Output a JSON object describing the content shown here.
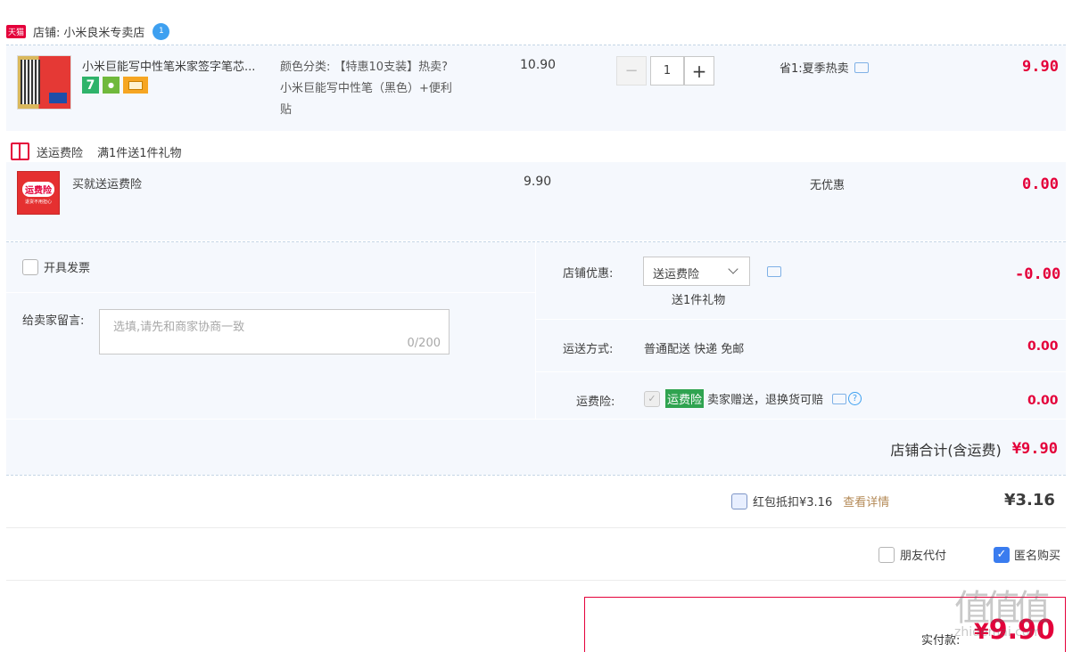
{
  "shop": {
    "badge": "天猫",
    "label": "店铺:",
    "name": "小米良米专卖店",
    "ww_badge": "1"
  },
  "item": {
    "title": "小米巨能写中性笔米家签字笔芯...",
    "sku_label": "颜色分类:",
    "sku_line1": "【特惠10支装】热卖?",
    "sku_line2": "小米巨能写中性笔（黑色）+便利",
    "sku_line3": "贴",
    "unit_price": "10.90",
    "qty_minus": "−",
    "qty": "1",
    "qty_plus": "+",
    "promo": "省1:夏季热卖",
    "total": "9.90",
    "badges": [
      "7",
      "保障",
      "卡"
    ]
  },
  "gift": {
    "label": "送运费险",
    "condition": "满1件送1件礼物",
    "icon_text": "运费险",
    "icon_sub": "退货不用担心",
    "name": "买就送运费险",
    "unit_price": "9.90",
    "promo": "无优惠",
    "total": "0.00"
  },
  "invoice": {
    "label": "开具发票"
  },
  "message": {
    "label": "给卖家留言:",
    "placeholder": "选填,请先和商家协商一致",
    "count": "0/200"
  },
  "shop_discount": {
    "label": "店铺优惠:",
    "selected": "送运费险",
    "sub": "送1件礼物",
    "value": "-0.00"
  },
  "shipping": {
    "label": "运送方式:",
    "method": "普通配送 快递 免邮",
    "value": "0.00"
  },
  "insurance": {
    "label": "运费险:",
    "tag": "运费险",
    "desc": "卖家赠送，退换货可赔",
    "help": "?",
    "value": "0.00"
  },
  "shop_total": {
    "label": "店铺合计(含运费)",
    "value": "¥9.90"
  },
  "redpacket": {
    "label": "红包抵扣¥3.16",
    "link": "查看详情",
    "value": "¥3.16"
  },
  "options": {
    "friend_pay": "朋友代付",
    "anonymous": "匿名购买"
  },
  "pay": {
    "label": "实付款:",
    "currency": "¥",
    "value": "9.90"
  },
  "watermark": {
    "logo": "值",
    "site": "zhidemai.com"
  },
  "colors": {
    "accent": "#e4003a",
    "blue": "#3a7cef",
    "box": "#f5f8fd"
  }
}
